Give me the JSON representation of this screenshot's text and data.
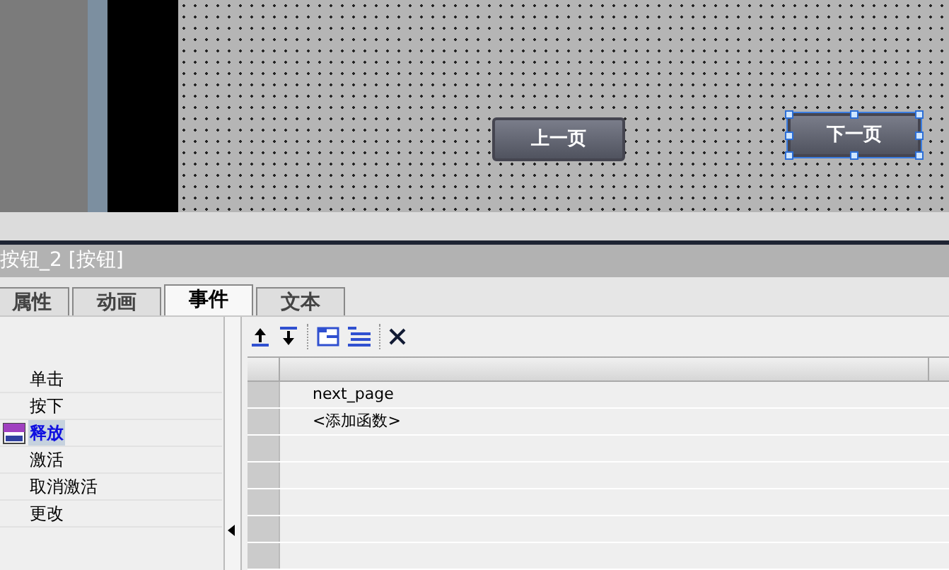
{
  "canvas": {
    "buttons": [
      {
        "label": "上一页",
        "selected": false
      },
      {
        "label": "下一页",
        "selected": true
      }
    ]
  },
  "inspector": {
    "title": "按钮_2 [按钮]",
    "tabs": [
      {
        "label": "属性",
        "selected": false
      },
      {
        "label": "动画",
        "selected": false
      },
      {
        "label": "事件",
        "selected": true
      },
      {
        "label": "文本",
        "selected": false
      }
    ],
    "events": [
      {
        "label": "单击",
        "selected": false
      },
      {
        "label": "按下",
        "selected": false
      },
      {
        "label": "释放",
        "selected": true
      },
      {
        "label": "激活",
        "selected": false
      },
      {
        "label": "取消激活",
        "selected": false
      },
      {
        "label": "更改",
        "selected": false
      }
    ],
    "functions": [
      "next_page",
      "<添加函数>"
    ]
  }
}
